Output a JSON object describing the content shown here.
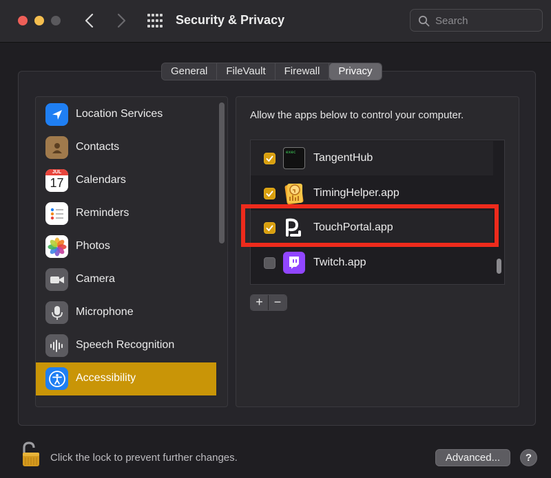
{
  "window": {
    "title": "Security & Privacy",
    "search_placeholder": "Search"
  },
  "tabs": [
    {
      "label": "General",
      "active": false
    },
    {
      "label": "FileVault",
      "active": false
    },
    {
      "label": "Firewall",
      "active": false
    },
    {
      "label": "Privacy",
      "active": true
    }
  ],
  "sidebar": {
    "items": [
      {
        "label": "Location Services",
        "icon": "location-arrow-icon"
      },
      {
        "label": "Contacts",
        "icon": "contacts-icon"
      },
      {
        "label": "Calendars",
        "icon": "calendar-icon",
        "month": "JUL",
        "day": "17"
      },
      {
        "label": "Reminders",
        "icon": "reminders-icon"
      },
      {
        "label": "Photos",
        "icon": "photos-icon"
      },
      {
        "label": "Camera",
        "icon": "camera-icon"
      },
      {
        "label": "Microphone",
        "icon": "microphone-icon"
      },
      {
        "label": "Speech Recognition",
        "icon": "speech-waveform-icon"
      },
      {
        "label": "Accessibility",
        "icon": "accessibility-icon",
        "selected": true
      }
    ]
  },
  "accessibility_pane": {
    "description": "Allow the apps below to control your computer.",
    "apps": [
      {
        "name": "TangentHub",
        "checked": true,
        "icon": "terminal-icon",
        "icon_text": "exec"
      },
      {
        "name": "TimingHelper.app",
        "checked": true,
        "icon": "timing-icon"
      },
      {
        "name": "TouchPortal.app",
        "checked": true,
        "icon": "touchportal-icon",
        "highlighted": true
      },
      {
        "name": "Twitch.app",
        "checked": false,
        "icon": "twitch-icon"
      }
    ],
    "add_label": "+",
    "remove_label": "−"
  },
  "footer": {
    "lock_text": "Click the lock to prevent further changes.",
    "advanced_label": "Advanced...",
    "help_label": "?"
  },
  "colors": {
    "accent": "#c99507",
    "checkbox_checked": "#d89f0f",
    "highlight_box": "#ee2b1c"
  }
}
